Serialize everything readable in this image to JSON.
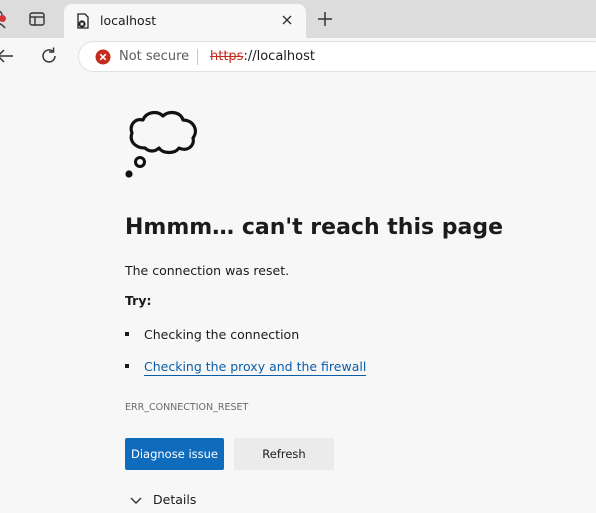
{
  "browser": {
    "tab": {
      "title": "localhost"
    },
    "address": {
      "security_label": "Not secure",
      "url_scheme": "https",
      "url_rest": "://localhost"
    }
  },
  "error_page": {
    "headline": "Hmmm… can't reach this page",
    "message": "The connection was reset.",
    "try_label": "Try:",
    "suggestions": [
      {
        "text": "Checking the connection"
      },
      {
        "text": "Checking the proxy and the firewall"
      }
    ],
    "error_code": "ERR_CONNECTION_RESET",
    "buttons": {
      "diagnose": "Diagnose issue",
      "refresh": "Refresh"
    },
    "details_label": "Details"
  },
  "icons": {
    "profile": "profile-icon",
    "tab_actions": "tab-actions-icon",
    "favicon": "broken-page-icon",
    "close": "close-icon",
    "new_tab": "plus-icon",
    "back": "back-arrow-icon",
    "refresh": "refresh-icon",
    "security": "not-secure-icon",
    "thought": "thought-cloud-icon",
    "chevron": "chevron-down-icon"
  },
  "colors": {
    "accent": "#0f6cbd",
    "link": "#0a5ea8",
    "warning": "#c42b1c"
  }
}
